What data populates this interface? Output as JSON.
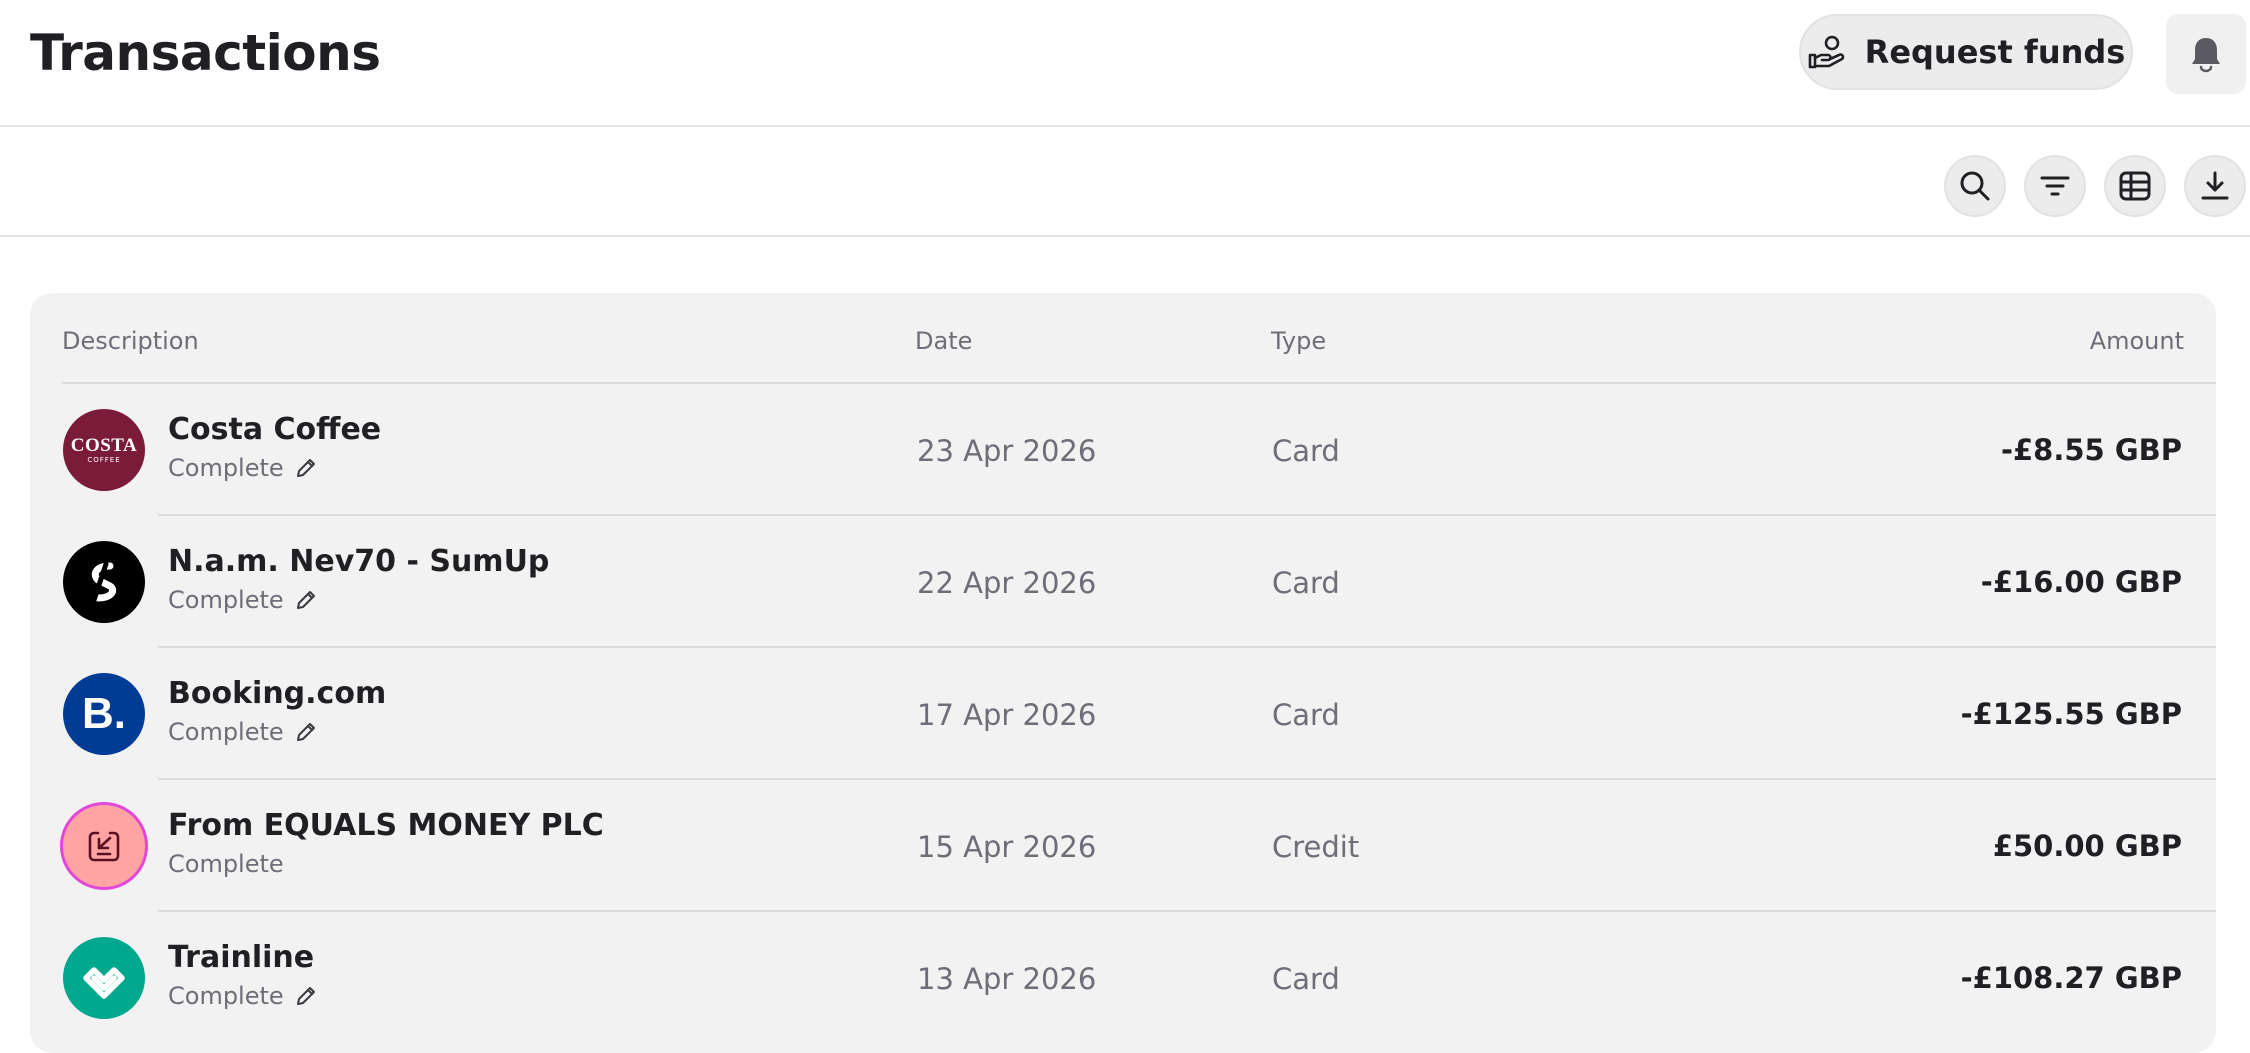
{
  "header": {
    "title": "Transactions",
    "request_funds_label": "Request funds"
  },
  "icons": {
    "request": "hand-coins-icon",
    "notifications": "bell-icon",
    "search": "search-icon",
    "filter": "filter-icon",
    "columns": "table-columns-icon",
    "download": "download-icon",
    "edit": "pencil-icon"
  },
  "colors": {
    "costa": "#7a1b3a",
    "sumup": "#000000",
    "booking": "#003b95",
    "equals_fill": "#ffa3a3",
    "equals_border": "#e247d8",
    "trainline": "#00a88e"
  },
  "table": {
    "columns": [
      "Description",
      "Date",
      "Type",
      "Amount"
    ],
    "rows": [
      {
        "merchant": "Costa Coffee",
        "logo_text": "COSTA",
        "logo_subtext": "COFFEE",
        "status": "Complete",
        "editable": true,
        "date": "23 Apr 2026",
        "type": "Card",
        "amount": "-£8.55 GBP"
      },
      {
        "merchant": "N.a.m. Nev70 - SumUp",
        "status": "Complete",
        "editable": true,
        "date": "22 Apr 2026",
        "type": "Card",
        "amount": "-£16.00 GBP"
      },
      {
        "merchant": "Booking.com",
        "logo_text": "B.",
        "status": "Complete",
        "editable": true,
        "date": "17 Apr 2026",
        "type": "Card",
        "amount": "-£125.55 GBP"
      },
      {
        "merchant": "From EQUALS MONEY PLC",
        "status": "Complete",
        "editable": false,
        "date": "15 Apr 2026",
        "type": "Credit",
        "amount": "£50.00 GBP"
      },
      {
        "merchant": "Trainline",
        "status": "Complete",
        "editable": true,
        "date": "13 Apr 2026",
        "type": "Card",
        "amount": "-£108.27 GBP"
      }
    ]
  }
}
